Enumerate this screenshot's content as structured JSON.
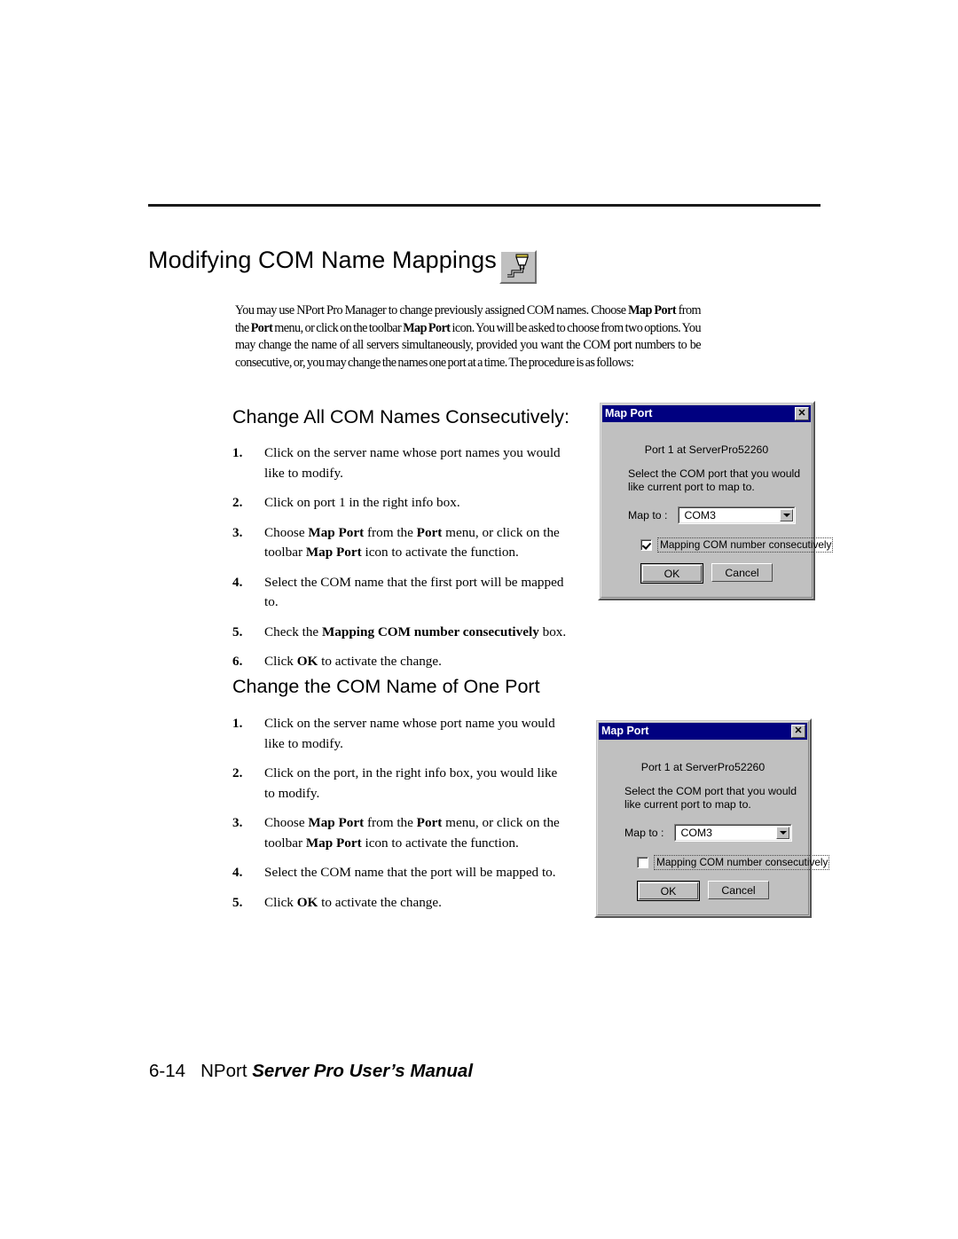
{
  "page": {
    "title": "Modifying COM Name Mappings",
    "title_icon": "map-port-toolbar-icon",
    "intro_html": "You may use NPort Pro Manager to change previously assigned COM names. Choose <b>Map Port</b> from the <b>Port</b> menu, or click on the toolbar <b>Map Port</b> icon. You will be asked to choose from two options. You may change the name of all servers simultaneously, provided you want the COM port numbers to be consecutive, or, you may change the names one port at a time. The procedure is as follows:"
  },
  "section_1": {
    "heading": "Change All COM Names Consecutively:",
    "steps": [
      {
        "num": "1.",
        "html": "Click on the server name whose port names you would like to modify."
      },
      {
        "num": "2.",
        "html": "Click on port 1 in the right info box."
      },
      {
        "num": "3.",
        "html": "Choose <b>Map Port</b> from the <b>Port</b> menu, or click on the toolbar <b>Map Port</b> icon to activate the function."
      },
      {
        "num": "4.",
        "html": "Select the COM name that the first port will be mapped to."
      },
      {
        "num": "5.",
        "html": "Check the <b>Mapping COM number consecutively</b> box."
      },
      {
        "num": "6.",
        "html": "Click <b>OK</b> to activate the change."
      }
    ]
  },
  "section_2": {
    "heading": "Change the COM Name of One Port",
    "steps": [
      {
        "num": "1.",
        "html": "Click on the server name whose port name you would like to modify."
      },
      {
        "num": "2.",
        "html": "Click on the port, in the right info box, you would like to modify."
      },
      {
        "num": "3.",
        "html": "Choose <b>Map Port</b> from the <b>Port</b> menu, or click on the toolbar <b>Map Port</b> icon to activate the function."
      },
      {
        "num": "4.",
        "html": "Select the COM name that the port will be mapped to."
      },
      {
        "num": "5.",
        "html": "Click <b>OK</b> to activate the change."
      }
    ]
  },
  "dialog_1": {
    "title": "Map Port",
    "close_label": "✕",
    "port_label": "Port 1 at ServerPro52260",
    "instruction_line1": "Select the COM port that you would",
    "instruction_line2": "like current port to map to.",
    "map_to_label": "Map to :",
    "combo_value": "COM3",
    "checkbox_label": "Mapping COM number consecutively",
    "checkbox_checked": "true",
    "ok_label": "OK",
    "cancel_label": "Cancel"
  },
  "dialog_2": {
    "title": "Map Port",
    "close_label": "✕",
    "port_label": "Port 1 at ServerPro52260",
    "instruction_line1": "Select the COM port that you would",
    "instruction_line2": "like current port to map to.",
    "map_to_label": "Map to :",
    "combo_value": "COM3",
    "checkbox_label": "Mapping COM number consecutively",
    "checkbox_checked": "false",
    "ok_label": "OK",
    "cancel_label": "Cancel"
  },
  "footer": {
    "page_number": "6-14",
    "product": "NPort",
    "manual_title": "Server Pro User’s Manual"
  },
  "colors": {
    "titlebar": "#000080",
    "dialog_face": "#c0c0c0",
    "text": "#000000"
  }
}
